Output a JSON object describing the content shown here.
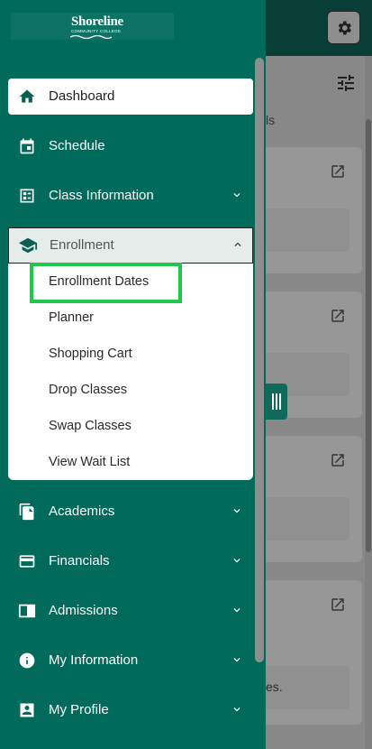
{
  "app": {
    "logo": {
      "name": "Shoreline",
      "sub": "COMMUNITY COLLEGE"
    }
  },
  "background": {
    "tab_fragment": "ls",
    "card_fragment": "es."
  },
  "nav": {
    "items": [
      {
        "label": "Dashboard",
        "icon": "home-icon"
      },
      {
        "label": "Schedule",
        "icon": "calendar-icon"
      },
      {
        "label": "Class Information",
        "icon": "class-info-icon"
      },
      {
        "label": "Enrollment",
        "icon": "graduation-cap-icon"
      },
      {
        "label": "Academics",
        "icon": "documents-icon"
      },
      {
        "label": "Financials",
        "icon": "credit-card-icon"
      },
      {
        "label": "Admissions",
        "icon": "admissions-icon"
      },
      {
        "label": "My Information",
        "icon": "info-icon"
      },
      {
        "label": "My Profile",
        "icon": "profile-icon"
      }
    ],
    "enrollment_submenu": [
      "Enrollment Dates",
      "Planner",
      "Shopping Cart",
      "Drop Classes",
      "Swap Classes",
      "View Wait List"
    ]
  },
  "colors": {
    "drawer": "#006a5b",
    "highlight": "#1fc84a",
    "text_dark": "#1f1f1f"
  }
}
